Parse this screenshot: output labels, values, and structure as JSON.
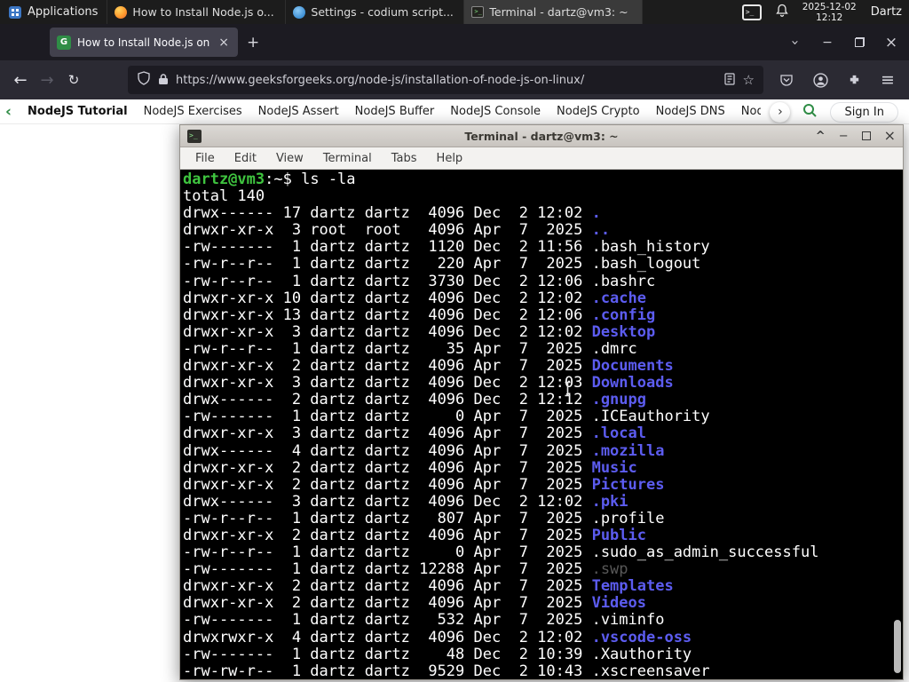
{
  "panel": {
    "applications_label": "Applications",
    "windows": [
      {
        "title": "How to Install Node.js o..."
      },
      {
        "title": "Settings - codium script..."
      },
      {
        "title": "Terminal - dartz@vm3: ~"
      }
    ],
    "clock": {
      "date": "2025-12-02",
      "time": "12:12"
    },
    "user_label": "Dartz"
  },
  "browser": {
    "tab_title": "How to Install Node.js on...",
    "favicon_letter": "G",
    "url": "https://www.geeksforgeeks.org/node-js/installation-of-node-js-on-linux/"
  },
  "site_nav": {
    "items": [
      "NodeJS Tutorial",
      "NodeJS Exercises",
      "NodeJS Assert",
      "NodeJS Buffer",
      "NodeJS Console",
      "NodeJS Crypto",
      "NodeJS DNS",
      "Node"
    ],
    "sign_in_label": "Sign In",
    "accent_green": "#2f8d46"
  },
  "icons": {
    "back": "←",
    "forward": "→",
    "reload": "↻",
    "star": "☆",
    "menu": "≡",
    "new_tab": "+",
    "close": "×",
    "minimize": "−",
    "tab_chevron": "›",
    "nav_chevron_left": "‹",
    "nav_chevron_right": "›",
    "shade": "^",
    "term_glyph": ">_"
  },
  "terminal": {
    "title": "Terminal - dartz@vm3: ~",
    "menu": [
      "File",
      "Edit",
      "View",
      "Terminal",
      "Tabs",
      "Help"
    ],
    "prompt": {
      "userhost": "dartz@vm3",
      "separator": ":",
      "path": "~",
      "symbol": "$ ",
      "command": "ls -la"
    },
    "total_line": "total 140",
    "listing": [
      {
        "meta": "drwx------ 17 dartz dartz  4096 Dec  2 12:02 ",
        "name": ".",
        "type": "dir"
      },
      {
        "meta": "drwxr-xr-x  3 root  root   4096 Apr  7  2025 ",
        "name": "..",
        "type": "dir"
      },
      {
        "meta": "-rw-------  1 dartz dartz  1120 Dec  2 11:56 ",
        "name": ".bash_history",
        "type": "file"
      },
      {
        "meta": "-rw-r--r--  1 dartz dartz   220 Apr  7  2025 ",
        "name": ".bash_logout",
        "type": "file"
      },
      {
        "meta": "-rw-r--r--  1 dartz dartz  3730 Dec  2 12:06 ",
        "name": ".bashrc",
        "type": "file"
      },
      {
        "meta": "drwxr-xr-x 10 dartz dartz  4096 Dec  2 12:02 ",
        "name": ".cache",
        "type": "dir"
      },
      {
        "meta": "drwxr-xr-x 13 dartz dartz  4096 Dec  2 12:06 ",
        "name": ".config",
        "type": "dir"
      },
      {
        "meta": "drwxr-xr-x  3 dartz dartz  4096 Dec  2 12:02 ",
        "name": "Desktop",
        "type": "dir"
      },
      {
        "meta": "-rw-r--r--  1 dartz dartz    35 Apr  7  2025 ",
        "name": ".dmrc",
        "type": "file"
      },
      {
        "meta": "drwxr-xr-x  2 dartz dartz  4096 Apr  7  2025 ",
        "name": "Documents",
        "type": "dir"
      },
      {
        "meta": "drwxr-xr-x  3 dartz dartz  4096 Dec  2 12:03 ",
        "name": "Downloads",
        "type": "dir"
      },
      {
        "meta": "drwx------  2 dartz dartz  4096 Dec  2 12:12 ",
        "name": ".gnupg",
        "type": "dir"
      },
      {
        "meta": "-rw-------  1 dartz dartz     0 Apr  7  2025 ",
        "name": ".ICEauthority",
        "type": "file"
      },
      {
        "meta": "drwxr-xr-x  3 dartz dartz  4096 Apr  7  2025 ",
        "name": ".local",
        "type": "dir"
      },
      {
        "meta": "drwx------  4 dartz dartz  4096 Apr  7  2025 ",
        "name": ".mozilla",
        "type": "dir"
      },
      {
        "meta": "drwxr-xr-x  2 dartz dartz  4096 Apr  7  2025 ",
        "name": "Music",
        "type": "dir"
      },
      {
        "meta": "drwxr-xr-x  2 dartz dartz  4096 Apr  7  2025 ",
        "name": "Pictures",
        "type": "dir"
      },
      {
        "meta": "drwx------  3 dartz dartz  4096 Dec  2 12:02 ",
        "name": ".pki",
        "type": "dir"
      },
      {
        "meta": "-rw-r--r--  1 dartz dartz   807 Apr  7  2025 ",
        "name": ".profile",
        "type": "file"
      },
      {
        "meta": "drwxr-xr-x  2 dartz dartz  4096 Apr  7  2025 ",
        "name": "Public",
        "type": "dir"
      },
      {
        "meta": "-rw-r--r--  1 dartz dartz     0 Apr  7  2025 ",
        "name": ".sudo_as_admin_successful",
        "type": "file"
      },
      {
        "meta": "-rw-------  1 dartz dartz 12288 Apr  7  2025 ",
        "name": ".swp",
        "type": "dim"
      },
      {
        "meta": "drwxr-xr-x  2 dartz dartz  4096 Apr  7  2025 ",
        "name": "Templates",
        "type": "dir"
      },
      {
        "meta": "drwxr-xr-x  2 dartz dartz  4096 Apr  7  2025 ",
        "name": "Videos",
        "type": "dir"
      },
      {
        "meta": "-rw-------  1 dartz dartz   532 Apr  7  2025 ",
        "name": ".viminfo",
        "type": "file"
      },
      {
        "meta": "drwxrwxr-x  4 dartz dartz  4096 Dec  2 12:02 ",
        "name": ".vscode-oss",
        "type": "dir"
      },
      {
        "meta": "-rw-------  1 dartz dartz    48 Dec  2 10:39 ",
        "name": ".Xauthority",
        "type": "file"
      },
      {
        "meta": "-rw-rw-r--  1 dartz dartz  9529 Dec  2 10:43 ",
        "name": ".xscreensaver",
        "type": "file"
      }
    ],
    "colors": {
      "background": "#000000",
      "foreground": "#ffffff",
      "directory": "#5c5cf0",
      "prompt_green": "#3fc43f",
      "dim_file": "#585858"
    }
  }
}
